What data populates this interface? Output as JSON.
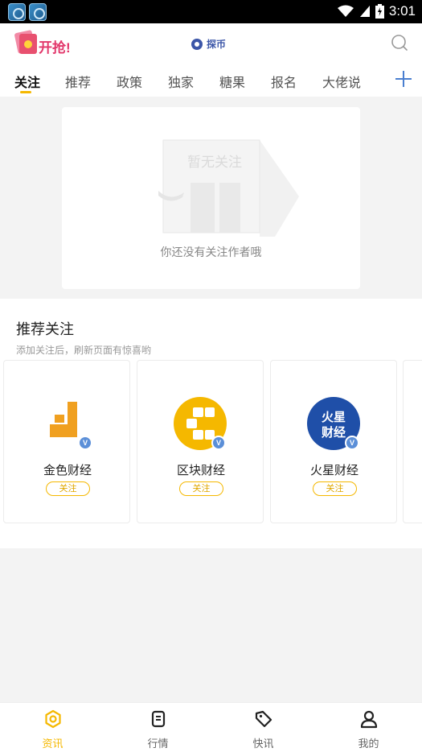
{
  "status_bar": {
    "time": "3:01"
  },
  "header": {
    "promo_text": "开抢!",
    "center_brand": "探币"
  },
  "tabs": [
    {
      "label": "关注",
      "active": true
    },
    {
      "label": "推荐",
      "active": false
    },
    {
      "label": "政策",
      "active": false
    },
    {
      "label": "独家",
      "active": false
    },
    {
      "label": "糖果",
      "active": false
    },
    {
      "label": "报名",
      "active": false
    },
    {
      "label": "大佬说",
      "active": false
    }
  ],
  "empty_state": {
    "illustration_text": "暂无关注",
    "message": "你还没有关注作者哦"
  },
  "recommend": {
    "title": "推荐关注",
    "subtitle": "添加关注后，刷新页面有惊喜哟",
    "cards": [
      {
        "name": "金色财经",
        "follow_label": "关注",
        "badge": "V"
      },
      {
        "name": "区块财经",
        "follow_label": "关注",
        "badge": "V"
      },
      {
        "name": "火星财经",
        "follow_label": "关注",
        "badge": "V",
        "logo_text": "火星财经"
      }
    ]
  },
  "bottom_nav": [
    {
      "label": "资讯",
      "icon": "news-icon",
      "active": true
    },
    {
      "label": "行情",
      "icon": "market-icon",
      "active": false
    },
    {
      "label": "快讯",
      "icon": "tag-icon",
      "active": false
    },
    {
      "label": "我的",
      "icon": "profile-icon",
      "active": false
    }
  ],
  "colors": {
    "accent": "#f5b800",
    "brand_blue": "#3c56a8",
    "badge_blue": "#5b8fd8"
  }
}
